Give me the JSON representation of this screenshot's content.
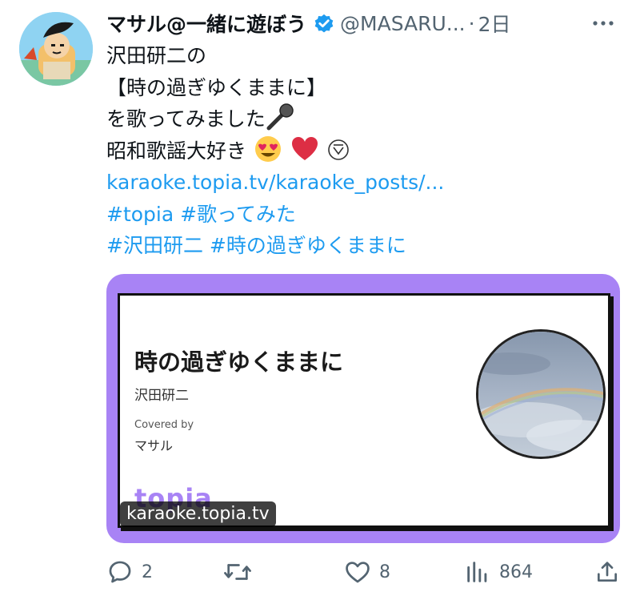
{
  "author": {
    "display_name": "マサル@一緒に遊ぼう",
    "handle": "@MASARU...",
    "separator": "·",
    "time": "2日"
  },
  "tweet": {
    "line1": "沢田研二の",
    "line2": "【時の過ぎゆくままに】",
    "line3": "を歌ってみました",
    "line4": "昭和歌謡大好き",
    "link": "karaoke.topia.tv/karaoke_posts/...",
    "hashtags_line1": [
      "#topia",
      "#歌ってみた"
    ],
    "hashtags_line2": [
      "#沢田研二",
      "#時の過ぎゆくままに"
    ],
    "emoji_icons": [
      "microphone-emoji",
      "heart-eyes-emoji",
      "red-heart-emoji",
      "downward-triangle-emoji"
    ]
  },
  "card": {
    "song_title": "時の過ぎゆくままに",
    "artist": "沢田研二",
    "covered_by_label": "Covered by",
    "cover_name": "マサル",
    "brand": "topia",
    "domain": "karaoke.topia.tv",
    "accent_color": "#a883f5"
  },
  "actions": {
    "replies": "2",
    "retweets": "",
    "likes": "8",
    "views": "864"
  },
  "colors": {
    "link": "#1d9bf0",
    "muted": "#536471",
    "text": "#0f1419"
  }
}
